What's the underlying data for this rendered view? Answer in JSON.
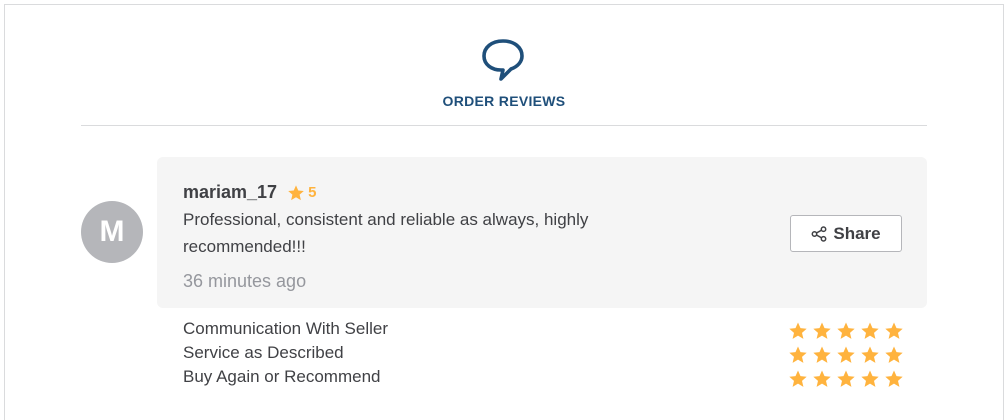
{
  "header": {
    "icon": "chat-bubble-icon",
    "title": "ORDER REVIEWS"
  },
  "review": {
    "avatar_initial": "M",
    "username": "mariam_17",
    "rating": "5",
    "text": "Professional, consistent and reliable as always, highly recommended!!!",
    "time": "36 minutes ago",
    "share_label": "Share"
  },
  "criteria": [
    {
      "label": "Communication With Seller",
      "stars": 5
    },
    {
      "label": "Service as Described",
      "stars": 5
    },
    {
      "label": "Buy Again or Recommend",
      "stars": 5
    }
  ],
  "colors": {
    "accent_blue": "#1f4f7a",
    "star_yellow": "#ffb33e",
    "card_bg": "#f5f5f5",
    "avatar_bg": "#b5b6ba"
  }
}
